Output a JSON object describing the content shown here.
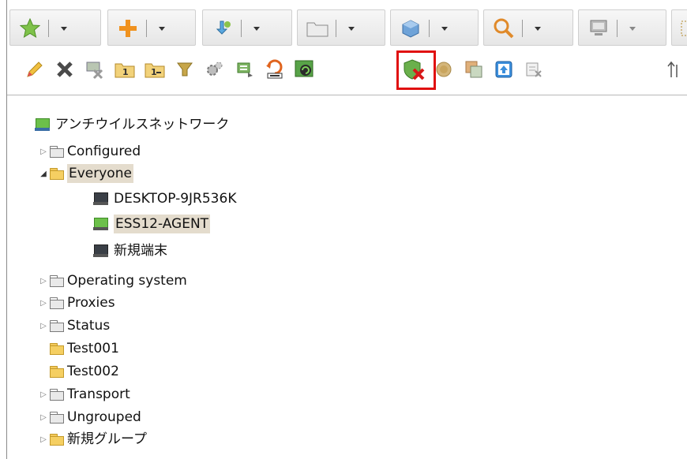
{
  "colors": {
    "highlight_box": "#e01010",
    "selection_bg": "#e4dccd",
    "folder_yellow": "#f5cf62",
    "agent_green": "#6cc04a"
  },
  "toolbar_top": [
    {
      "icon": "star-icon"
    },
    {
      "icon": "plus-icon"
    },
    {
      "icon": "install-arrow-icon"
    },
    {
      "icon": "folder-icon"
    },
    {
      "icon": "cube-icon"
    },
    {
      "icon": "magnifier-icon"
    },
    {
      "icon": "monitor-icon"
    }
  ],
  "toolbar_actions": [
    "edit-pencil-icon",
    "delete-x-icon",
    "remove-agent-icon",
    "group-1-icon",
    "group-1b-icon",
    "filter-icon",
    "settings-gear-icon",
    "export-icon",
    "restore-icon",
    "update-icon",
    "shield-disable-icon",
    "shield-icon",
    "merge-icon",
    "upload-icon",
    "export-grid-icon",
    "sort-arrow-icon"
  ],
  "tree": {
    "root_label": "アンチウイルスネットワーク",
    "groups": [
      {
        "label": "Configured"
      },
      {
        "label": "Everyone"
      },
      {
        "label": "Operating system"
      },
      {
        "label": "Proxies"
      },
      {
        "label": "Status"
      },
      {
        "label": "Test001"
      },
      {
        "label": "Test002"
      },
      {
        "label": "Transport"
      },
      {
        "label": "Ungrouped"
      },
      {
        "label": "新規グループ"
      }
    ],
    "everyone_children": [
      {
        "label": "DESKTOP-9JR536K"
      },
      {
        "label": "ESS12-AGENT"
      },
      {
        "label": "新規端末"
      }
    ]
  }
}
